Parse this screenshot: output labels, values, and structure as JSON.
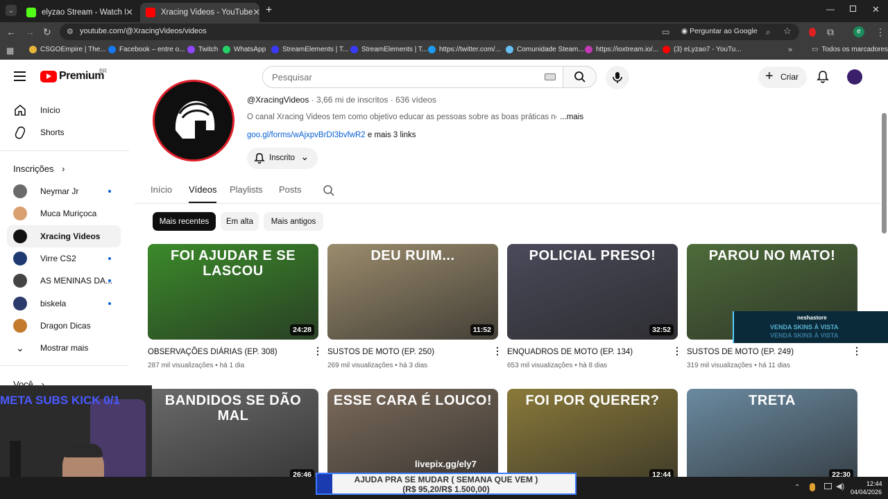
{
  "browser": {
    "tabs": [
      {
        "title": "elyzao Stream - Watch Live on",
        "active": false,
        "favicon_color": "#53fc18"
      },
      {
        "title": "Xracing Videos - YouTube",
        "active": true,
        "favicon_color": "#ff0000"
      }
    ],
    "url": "youtube.com/@XracingVideos/videos",
    "ask_google": "Perguntar ao Google",
    "profile_initial": "e",
    "bookmarks": [
      {
        "label": "CSGOEmpire | The...",
        "color": "#e8b339"
      },
      {
        "label": "Facebook – entre o...",
        "color": "#1877f2"
      },
      {
        "label": "Twitch",
        "color": "#9146ff"
      },
      {
        "label": "WhatsApp",
        "color": "#25d366"
      },
      {
        "label": "StreamElements | T...",
        "color": "#3a3aff"
      },
      {
        "label": "StreamElements | T...",
        "color": "#3a3aff"
      },
      {
        "label": "https://twitter.com/...",
        "color": "#1d9bf0"
      },
      {
        "label": "Comunidade Steam...",
        "color": "#66c0f4"
      },
      {
        "label": "https://ioxtream.io/...",
        "color": "#c239b3"
      },
      {
        "label": "(3) eLyzao7 - YouTu...",
        "color": "#ff0000"
      }
    ],
    "all_bookmarks": "Todos os marcadores"
  },
  "header": {
    "logo": "Premium",
    "region": "BR",
    "search_placeholder": "Pesquisar",
    "create": "Criar"
  },
  "sidebar": {
    "main": [
      {
        "label": "Início",
        "icon": "home-icon"
      },
      {
        "label": "Shorts",
        "icon": "shorts-icon"
      }
    ],
    "subs_title": "Inscrições",
    "subs": [
      {
        "label": "Neymar Jr",
        "color": "#6a6a6a",
        "dot": true,
        "selected": false
      },
      {
        "label": "Muca Muriçoca",
        "color": "#d9a070",
        "dot": false,
        "selected": false
      },
      {
        "label": "Xracing Videos",
        "color": "#111111",
        "dot": false,
        "selected": true
      },
      {
        "label": "Virre CS2",
        "color": "#1e3a70",
        "dot": true,
        "selected": false
      },
      {
        "label": "AS MENINAS DA...",
        "color": "#444444",
        "dot": true,
        "selected": false
      },
      {
        "label": "biskela",
        "color": "#2a3a6a",
        "dot": true,
        "selected": false
      },
      {
        "label": "Dragon Dicas",
        "color": "#c47a2c",
        "dot": false,
        "selected": false
      }
    ],
    "show_more": "Mostrar mais",
    "you": "Você"
  },
  "channel": {
    "handle": "@XracingVideos",
    "subscribers": "3,66 mi de inscritos",
    "video_count": "636 vídeos",
    "description": "O canal Xracing Videos tem como objetivo educar as pessoas sobre as boas práticas no...",
    "more": "...mais",
    "link": "goo.gl/forms/wAjxpvBrDI3bvfwR2",
    "more_links": "e mais 3 links",
    "subscribed": "Inscrito",
    "tabs": [
      "Início",
      "Vídeos",
      "Playlists",
      "Posts"
    ],
    "active_tab": 1,
    "filters": [
      "Mais recentes",
      "Em alta",
      "Mais antigos"
    ]
  },
  "videos": [
    {
      "thumb_text": "FOI AJUDAR E SE LASCOU",
      "bg": "#3b8a2a",
      "duration": "24:28",
      "title": "OBSERVAÇÕES DIÁRIAS (EP. 308)",
      "views": "287 mil visualizações",
      "age": "há 1 dia"
    },
    {
      "thumb_text": "DEU RUIM...",
      "bg": "#9a8b6c",
      "duration": "11:52",
      "title": "SUSTOS DE MOTO (EP. 250)",
      "views": "269 mil visualizações",
      "age": "há 3 dias"
    },
    {
      "thumb_text": "POLICIAL PRESO!",
      "bg": "#4a4a5a",
      "duration": "32:52",
      "title": "ENQUADROS DE MOTO (EP. 134)",
      "views": "653 mil visualizações",
      "age": "há 8 dias"
    },
    {
      "thumb_text": "PAROU NO MATO!",
      "bg": "#4e6b3a",
      "duration": "",
      "title": "SUSTOS DE MOTO (EP. 249)",
      "views": "319 mil visualizações",
      "age": "há 11 dias"
    },
    {
      "thumb_text": "BANDIDOS SE DÃO MAL",
      "bg": "#6a6a6a",
      "duration": "26:46",
      "title": "",
      "views": "",
      "age": ""
    },
    {
      "thumb_text": "ESSE CARA É LOUCO!",
      "bg": "#7a6a5a",
      "duration": "",
      "title": "",
      "views": "",
      "age": ""
    },
    {
      "thumb_text": "FOI POR QUERER?",
      "bg": "#8a7a3a",
      "duration": "12:44",
      "title": "",
      "views": "",
      "age": ""
    },
    {
      "thumb_text": "TRETA",
      "bg": "#6a8aa0",
      "duration": "22:30",
      "title": "",
      "views": "",
      "age": ""
    }
  ],
  "overlay": {
    "webcam_text": "META SUBS KICK 0/1",
    "donation_line1": "AJUDA PRA SE MUDAR ( SEMANA QUE VEM )",
    "donation_line2": "(R$ 95,20/R$ 1.500,00)",
    "livepix": "livepix.gg/ely7",
    "store_name": "neshastore",
    "store_text": "VENDA SKINS À VISTA"
  },
  "taskbar": {
    "time": "12:44",
    "date": "04/04/2026"
  }
}
